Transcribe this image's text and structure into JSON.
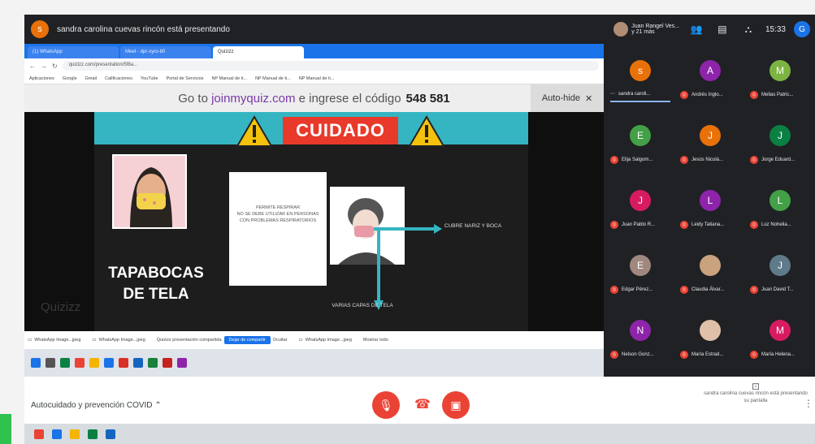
{
  "topbar": {
    "presenter_initial": "s",
    "presenter_text": "sandra carolina cuevas rincón está presentando",
    "user_name": "Juan Rangel Ves...",
    "user_sub": "y 21 más",
    "time": "15:33",
    "me_initial": "G"
  },
  "browser": {
    "tabs": [
      "(1) WhatsApp",
      "Meet - dpr-xyro-bfi",
      "Quizizz",
      ""
    ],
    "url": "quizizz.com/presentation/5f8a...",
    "bookmarks": [
      "Aplicaciones",
      "Google",
      "Gmail",
      "Calificaciones",
      "YouTube",
      "Portal de Servicios",
      "NP Manual de ti...",
      "NP Manual de ti...",
      "NP Manual de ti..."
    ]
  },
  "quiz": {
    "go_to": "Go to",
    "site": "joinmyquiz.com",
    "ingrese": "e ingrese el código",
    "code": "548 581",
    "autohide": "Auto-hide"
  },
  "slide": {
    "title": "CUIDADO",
    "heading_line1": "TAPABOCAS",
    "heading_line2": "DE TELA",
    "bullets": [
      "PERMITE RESPIRAR",
      "NO SE DEBE UTILIZAR EN PERSONAS CON PROBLEMAS RESPIRATORIOS"
    ],
    "label_right": "CUBRE NARIZ Y BOCA",
    "label_bottom": "VARIAS CAPAS DE TELA",
    "watermark": "Quizizz"
  },
  "downloads": [
    {
      "name": "WhatsApp Image...jpeg"
    },
    {
      "name": "WhatsApp Image...jpeg"
    },
    {
      "name": "Quizizz presentación compartida"
    },
    {
      "name": "WhatsApp Image...jpeg"
    }
  ],
  "downloads_action": "Dejar de compartir",
  "downloads_hide": "Ocultar",
  "downloads_showall": "Mostrar todo",
  "participants": [
    {
      "initial": "s",
      "name": "sandra caroli...",
      "color": "#e8710a",
      "muted": false
    },
    {
      "initial": "A",
      "name": "Andrés Inglo...",
      "color": "#8e24aa",
      "muted": true
    },
    {
      "initial": "M",
      "name": "Mellas Patric...",
      "color": "#7cb342",
      "muted": true
    },
    {
      "initial": "E",
      "name": "Elija Salgom...",
      "color": "#43a047",
      "muted": true
    },
    {
      "initial": "J",
      "name": "Jesús Nicolá...",
      "color": "#e8710a",
      "muted": true
    },
    {
      "initial": "J",
      "name": "Jorge Eduard...",
      "color": "#0b8043",
      "muted": true
    },
    {
      "initial": "J",
      "name": "Juan Pablo R...",
      "color": "#d81b60",
      "muted": true
    },
    {
      "initial": "L",
      "name": "Leidy Tatiana...",
      "color": "#8e24aa",
      "muted": true
    },
    {
      "initial": "L",
      "name": "Luz Nohelia...",
      "color": "#43a047",
      "muted": true
    },
    {
      "initial": "E",
      "name": "Edgar Pérez...",
      "color": "#a1887f",
      "muted": true
    },
    {
      "initial": "",
      "name": "Claudia Álvar...",
      "color": "#c9a27e",
      "muted": true
    },
    {
      "initial": "J",
      "name": "Juan David T...",
      "color": "#5f7a8a",
      "muted": true
    },
    {
      "initial": "N",
      "name": "Nelson Gonz...",
      "color": "#8e24aa",
      "muted": true
    },
    {
      "initial": "",
      "name": "María Estrad...",
      "color": "#e0c0a8",
      "muted": true
    },
    {
      "initial": "M",
      "name": "María Helena...",
      "color": "#d81b60",
      "muted": true
    }
  ],
  "controls": {
    "meeting_name": "Autocuidado y prevención COVID",
    "present_text": "sandra carolina cuevas rincón está presentando su pantalla"
  },
  "colors": {
    "accent_red": "#ea4335",
    "slide_banner": "#35b5c1",
    "meet_dark": "#202124"
  }
}
